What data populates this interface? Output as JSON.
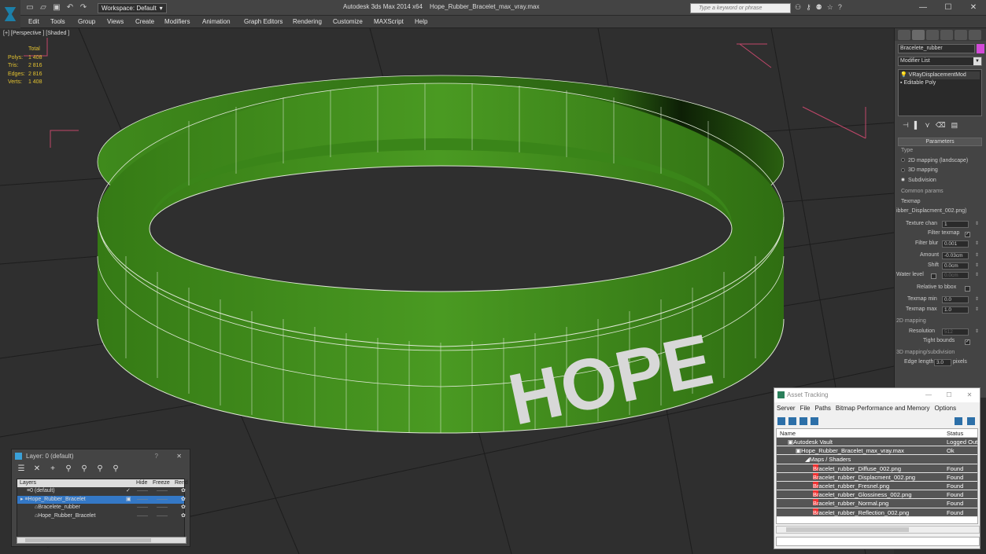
{
  "window": {
    "app_title": "Autodesk 3ds Max  2014 x64",
    "file_title": "Hope_Rubber_Bracelet_max_vray.max",
    "workspace_label": "Workspace: Default",
    "search_placeholder": "Type a keyword or phrase",
    "controls": [
      "—",
      "☐",
      "✕"
    ]
  },
  "menu": [
    "Edit",
    "Tools",
    "Group",
    "Views",
    "Create",
    "Modifiers",
    "Animation",
    "Graph Editors",
    "Rendering",
    "Customize",
    "MAXScript",
    "Help"
  ],
  "viewport": {
    "label": "[+] [Perspective ] [Shaded ]",
    "stats_header": "Total",
    "stats": [
      {
        "label": "Polys:",
        "value": "1 408"
      },
      {
        "label": "Tris:",
        "value": "2 816"
      },
      {
        "label": "Edges:",
        "value": "2 816"
      },
      {
        "label": "Verts:",
        "value": "1 408"
      }
    ],
    "bracelet_text": "HOPE",
    "colors": {
      "bracelet": "#3f8f1c",
      "wire": "#e8f0e0",
      "grid": "#1c1c1c",
      "bbox": "#c0476a"
    }
  },
  "command_panel": {
    "object_name": "Bracelete_rubber",
    "modifier_list": "Modifier List",
    "stack": [
      "VRayDisplacementMod",
      "Editable Poly"
    ],
    "rollout": "Parameters",
    "type_label": "Type",
    "type_options": [
      "2D mapping (landscape)",
      "3D mapping",
      "Subdivision"
    ],
    "common_label": "Common params",
    "texmap_label": "Texmap",
    "texmap_value": "ibber_Displacment_002.png)",
    "texture_chan_label": "Texture chan",
    "texture_chan": "1",
    "filter_texmap": "Filter texmap",
    "filter_blur_label": "Filter blur",
    "filter_blur": "0.001",
    "amount_label": "Amount",
    "amount": "-0.03cm",
    "shift_label": "Shift",
    "shift": "0.0cm",
    "water_label": "Water level",
    "water": "0.0cm",
    "relative_label": "Relative to bbox",
    "texmap_min_label": "Texmap min",
    "texmap_min": "0.0",
    "texmap_max_label": "Texmap max",
    "texmap_max": "1.0",
    "mapping2d_label": "2D mapping",
    "resolution_label": "Resolution",
    "resolution": "512",
    "tight_label": "Tight bounds",
    "mapping3d_label": "3D mapping/subdivision",
    "edge_label": "Edge length",
    "edge": "3.0",
    "edge_unit": "pixels"
  },
  "layer_window": {
    "title": "Layer: 0 (default)",
    "help": "?",
    "close": "✕",
    "columns": [
      "Layers",
      "Hide",
      "Freeze",
      "Rend"
    ],
    "rows": [
      {
        "name": "0 (default)",
        "indent": 1,
        "check": "✓"
      },
      {
        "name": "Hope_Rubber_Bracelet",
        "indent": 0,
        "check": "▣"
      },
      {
        "name": "Bracelete_rubber",
        "indent": 2,
        "check": ""
      },
      {
        "name": "Hope_Rubber_Bracelet",
        "indent": 2,
        "check": ""
      }
    ],
    "cell_dash": "——"
  },
  "asset_window": {
    "title": "Asset Tracking",
    "menu": [
      "Server",
      "File",
      "Paths",
      "Bitmap Performance and Memory",
      "Options"
    ],
    "columns": [
      "Name",
      "Status"
    ],
    "rows": [
      {
        "name": "Autodesk Vault",
        "status": "Logged Out"
      },
      {
        "name": "Hope_Rubber_Bracelet_max_vray.max",
        "status": "Ok"
      },
      {
        "name": "Maps / Shaders",
        "status": ""
      },
      {
        "name": "Bracelet_rubber_Diffuse_002.png",
        "status": "Found"
      },
      {
        "name": "Bracelet_rubber_Displacment_002.png",
        "status": "Found"
      },
      {
        "name": "Bracelet_rubber_Fresnel.png",
        "status": "Found"
      },
      {
        "name": "Bracelet_rubber_Glossiness_002.png",
        "status": "Found"
      },
      {
        "name": "Bracelet_rubber_Normal.png",
        "status": "Found"
      },
      {
        "name": "Bracelet_rubber_Reflection_002.png",
        "status": "Found"
      }
    ]
  }
}
